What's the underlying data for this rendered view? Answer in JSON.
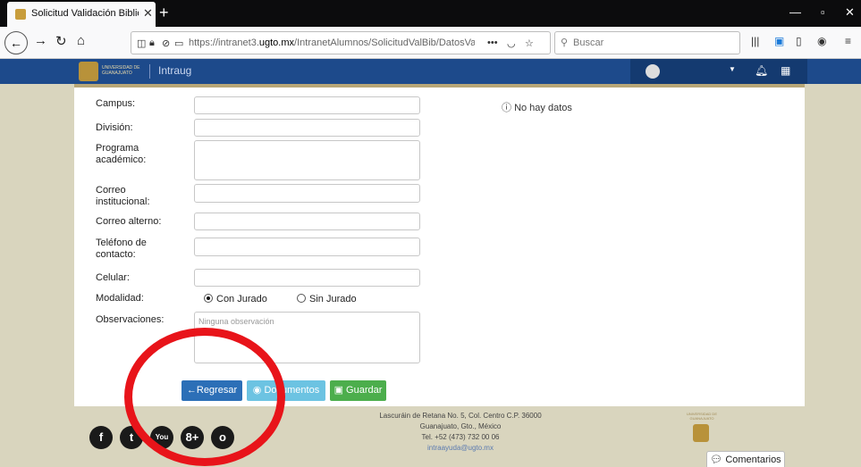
{
  "browser": {
    "tab_title": "Solicitud Validación Biblioteca",
    "tab_close": "✕",
    "new_tab": "+",
    "url_prefix": "https://intranet3.",
    "url_domain": "ugto.mx",
    "url_path": "/IntranetAlumnos/SolicitudValBib/DatosValidacion?id...",
    "url_more": "•••",
    "search_placeholder": "Buscar"
  },
  "site": {
    "logo_text": "UNIVERSIDAD DE GUANAJUATO",
    "brand": "Intraug"
  },
  "form": {
    "fields": [
      {
        "label": "Campus:"
      },
      {
        "label": "División:"
      },
      {
        "label": "Programa académico:"
      },
      {
        "label": "Correo institucional:"
      },
      {
        "label": "Correo alterno:"
      },
      {
        "label": "Teléfono de contacto:"
      },
      {
        "label": "Celular:"
      }
    ],
    "modalidad_label": "Modalidad:",
    "option_con": "Con Jurado",
    "option_sin": "Sin Jurado",
    "selected": "Con Jurado",
    "observaciones_label": "Observaciones:",
    "observaciones_placeholder": "Ninguna observación",
    "no_data": "No hay datos"
  },
  "buttons": {
    "regresar": "Regresar",
    "documentos": "Documentos",
    "guardar": "Guardar"
  },
  "footer": {
    "address_line1": "Lascuráin de Retana No. 5, Col. Centro C.P. 36000",
    "address_line2": "Guanajuato, Gto., México",
    "phone": "Tel. +52 (473) 732 00 06",
    "email": "intraayuda@ugto.mx",
    "seal_text": "UNIVERSIDAD DE GUANAJUATO",
    "comments": "Comentarios",
    "social": [
      "f",
      "t",
      "You",
      "8+",
      "o"
    ]
  },
  "colors": {
    "header": "#1d4a8b",
    "btn_primary": "#2c6fb7",
    "btn_info": "#6cc3e2",
    "btn_success": "#4cae4c",
    "annotation": "#e8141a"
  }
}
